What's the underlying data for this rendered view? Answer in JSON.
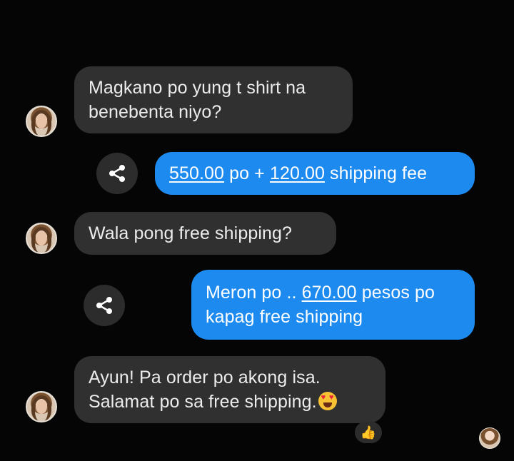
{
  "messages": [
    {
      "sender": "other",
      "lines": [
        "Magkano po yung t shirt na",
        "benebenta niyo?"
      ]
    },
    {
      "sender": "me",
      "parts": [
        {
          "t": "550.00",
          "u": true
        },
        {
          "t": " po + ",
          "u": false
        },
        {
          "t": "120.00",
          "u": true
        },
        {
          "t": " shipping fee",
          "u": false
        }
      ]
    },
    {
      "sender": "other",
      "lines": [
        "Wala pong free shipping?"
      ]
    },
    {
      "sender": "me",
      "line1": [
        {
          "t": "Meron po .. ",
          "u": false
        },
        {
          "t": "670.00",
          "u": true
        },
        {
          "t": " pesos po",
          "u": false
        }
      ],
      "line2": "kapag free shipping"
    },
    {
      "sender": "other",
      "lines": [
        "Ayun! Pa order po akong isa.",
        "Salamat po sa free shipping."
      ],
      "emoji": "heart-eyes-emoji"
    }
  ],
  "reaction": {
    "icon": "thumbs-up-icon",
    "glyph": "👍"
  },
  "icons": {
    "share": "share-icon",
    "avatar": "avatar",
    "seen": "seen-avatar"
  },
  "colors": {
    "background": "#050505",
    "incoming": "#303030",
    "outgoing": "#1d8af0"
  }
}
